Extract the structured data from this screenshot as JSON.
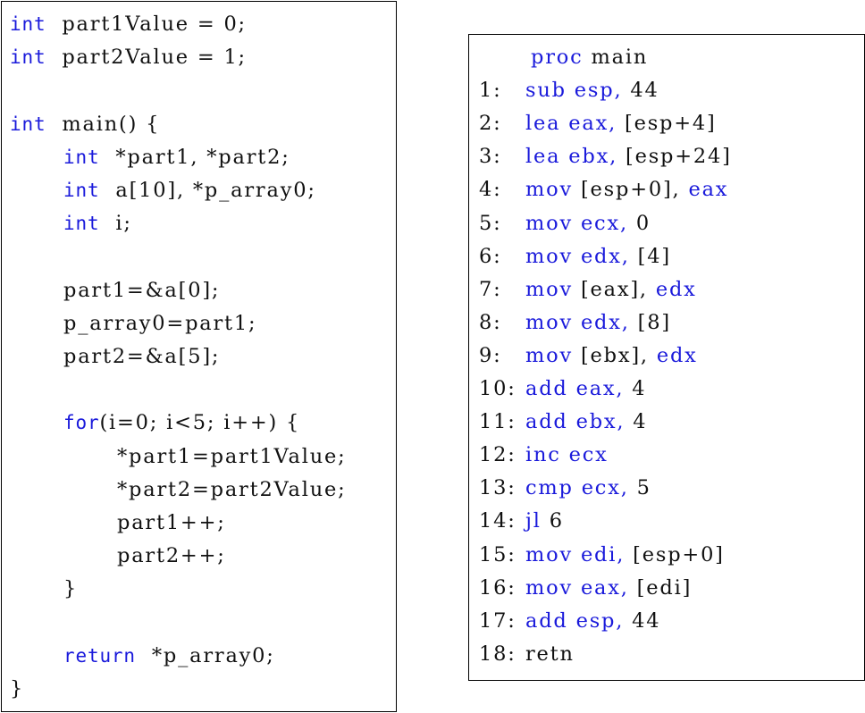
{
  "c_code": {
    "lines": [
      {
        "indent": 0,
        "kw": "int",
        "rest": "part1Value = 0;"
      },
      {
        "indent": 0,
        "kw": "int",
        "rest": "part2Value = 1;"
      },
      {
        "indent": 0,
        "kw": "",
        "rest": ""
      },
      {
        "indent": 0,
        "kw": "int",
        "rest": "main() {"
      },
      {
        "indent": 1,
        "kw": "int",
        "rest": "*part1, *part2;"
      },
      {
        "indent": 1,
        "kw": "int",
        "rest": "a[10], *p_array0;"
      },
      {
        "indent": 1,
        "kw": "int",
        "rest": "i;"
      },
      {
        "indent": 0,
        "kw": "",
        "rest": ""
      },
      {
        "indent": 1,
        "kw": "",
        "rest": "part1=&a[0];"
      },
      {
        "indent": 1,
        "kw": "",
        "rest": "p_array0=part1;"
      },
      {
        "indent": 1,
        "kw": "",
        "rest": "part2=&a[5];"
      },
      {
        "indent": 0,
        "kw": "",
        "rest": ""
      },
      {
        "indent": 1,
        "kw": "for",
        "rest": "(i=0; i<5; i++) {"
      },
      {
        "indent": 2,
        "kw": "",
        "rest": "*part1=part1Value;"
      },
      {
        "indent": 2,
        "kw": "",
        "rest": "*part2=part2Value;"
      },
      {
        "indent": 2,
        "kw": "",
        "rest": "part1++;"
      },
      {
        "indent": 2,
        "kw": "",
        "rest": "part2++;"
      },
      {
        "indent": 1,
        "kw": "",
        "rest": "}"
      },
      {
        "indent": 0,
        "kw": "",
        "rest": ""
      },
      {
        "indent": 1,
        "kw": "return",
        "rest": "*p_array0;"
      },
      {
        "indent": 0,
        "kw": "",
        "rest": "}"
      }
    ]
  },
  "asm_code": {
    "header": {
      "kw": "proc",
      "rest": "main"
    },
    "lines": [
      {
        "num": "1:",
        "op": "sub esp,",
        "arg": "44"
      },
      {
        "num": "2:",
        "op": "lea eax,",
        "arg": "[esp+4]"
      },
      {
        "num": "3:",
        "op": "lea ebx,",
        "arg": "[esp+24]"
      },
      {
        "num": "4:",
        "op": "mov",
        "arg": "[esp+0],",
        "tail": "eax"
      },
      {
        "num": "5:",
        "op": "mov ecx,",
        "arg": "0"
      },
      {
        "num": "6:",
        "op": "mov edx,",
        "arg": "[4]"
      },
      {
        "num": "7:",
        "op": "mov",
        "arg": "[eax],",
        "tail": "edx"
      },
      {
        "num": "8:",
        "op": "mov edx,",
        "arg": "[8]"
      },
      {
        "num": "9:",
        "op": "mov",
        "arg": "[ebx],",
        "tail": "edx"
      },
      {
        "num": "10:",
        "op": "add eax,",
        "arg": "4"
      },
      {
        "num": "11:",
        "op": "add ebx,",
        "arg": "4"
      },
      {
        "num": "12:",
        "op": "inc ecx",
        "arg": ""
      },
      {
        "num": "13:",
        "op": "cmp ecx,",
        "arg": "5"
      },
      {
        "num": "14:",
        "op": "jl",
        "arg": "6"
      },
      {
        "num": "15:",
        "op": "mov edi,",
        "arg": "[esp+0]"
      },
      {
        "num": "16:",
        "op": "mov eax,",
        "arg": "[edi]"
      },
      {
        "num": "17:",
        "op": "add esp,",
        "arg": "44"
      },
      {
        "num": "18:",
        "op": "",
        "arg": "retn"
      }
    ]
  },
  "colors": {
    "keyword": "#1a1adb",
    "text": "#111111",
    "border": "#000000"
  }
}
